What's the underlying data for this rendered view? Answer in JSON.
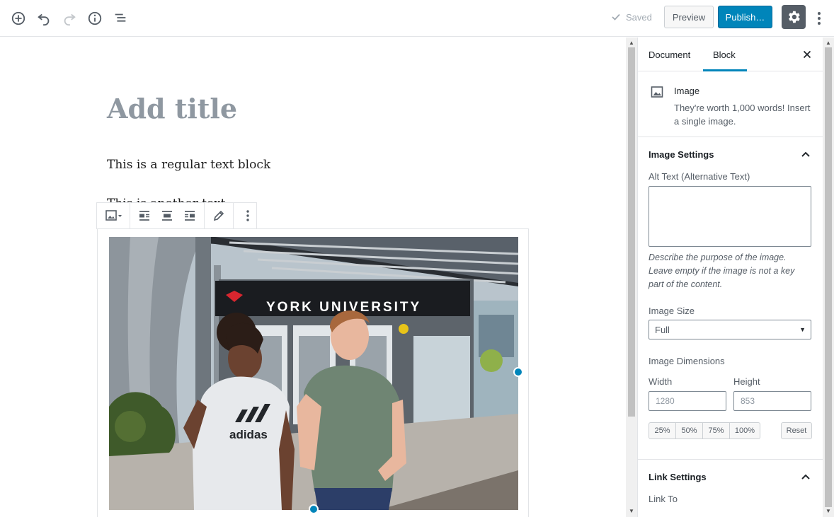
{
  "toolbar": {
    "saved_label": "Saved",
    "preview_label": "Preview",
    "publish_label": "Publish…",
    "accent_color": "#0085ba"
  },
  "editor": {
    "title_placeholder": "Add title",
    "paragraph_1": "This is a regular text block",
    "paragraph_2": "This is another text block"
  },
  "image_photo": {
    "sign_text": "YORK UNIVERSITY",
    "shirt_text": "adidas"
  },
  "sidebar": {
    "tabs": [
      {
        "label": "Document"
      },
      {
        "label": "Block"
      }
    ],
    "block_card": {
      "title": "Image",
      "description": "They're worth 1,000 words! Insert a single image."
    },
    "image_settings": {
      "heading": "Image Settings",
      "alt_label": "Alt Text (Alternative Text)",
      "alt_value": "",
      "alt_help": "Describe the purpose of the image. Leave empty if the image is not a key part of the content.",
      "size_label": "Image Size",
      "size_value": "Full",
      "dimensions_label": "Image Dimensions",
      "width_label": "Width",
      "width_value": "1280",
      "height_label": "Height",
      "height_value": "853",
      "percent_buttons": [
        "25%",
        "50%",
        "75%",
        "100%"
      ],
      "reset_label": "Reset"
    },
    "link_settings": {
      "heading": "Link Settings",
      "link_to_label": "Link To"
    }
  }
}
